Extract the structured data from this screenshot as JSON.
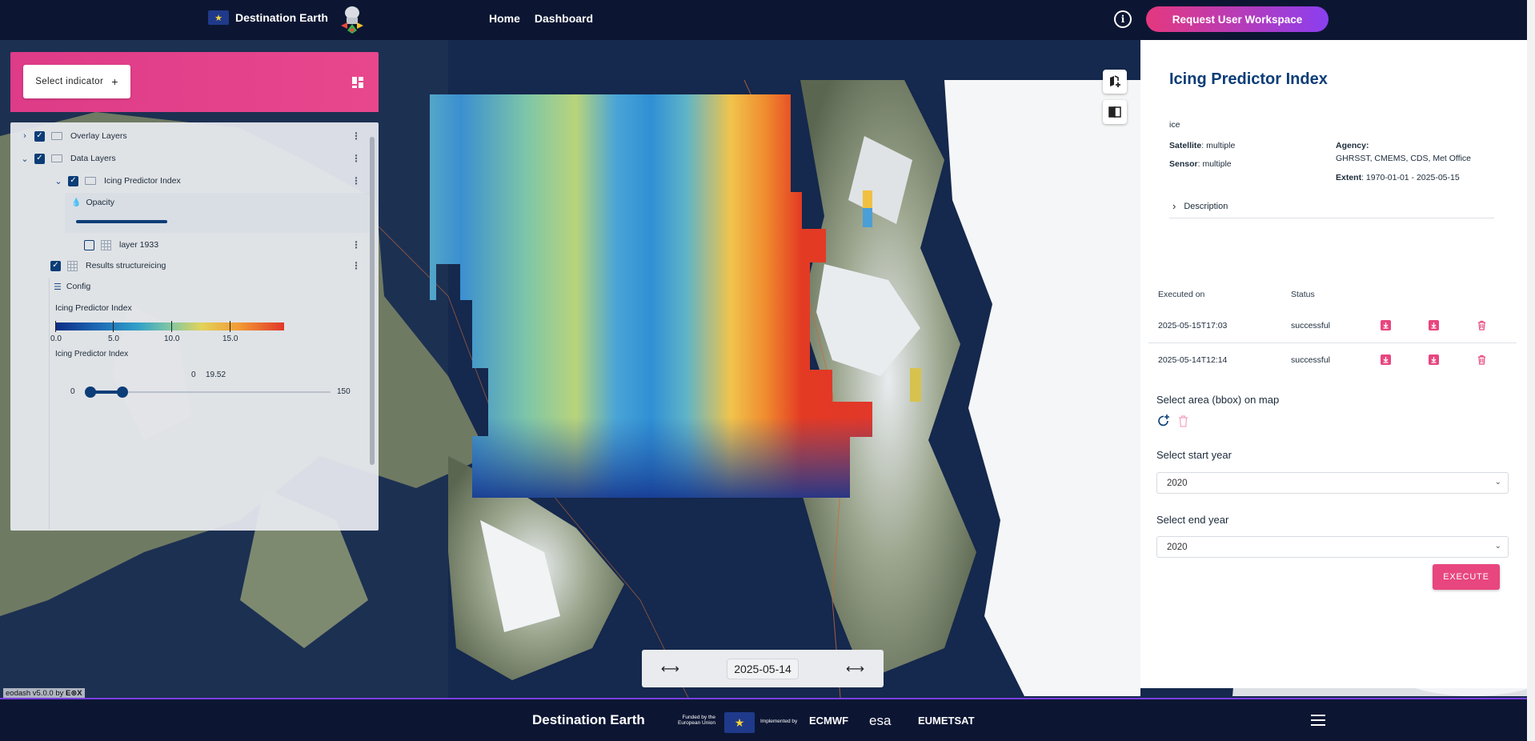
{
  "header": {
    "brand": "Destination Earth",
    "nav": [
      "Home",
      "Dashboard"
    ],
    "workspace_button": "Request User Workspace"
  },
  "left_panel": {
    "select_indicator": "Select indicator",
    "layers": {
      "overlay": "Overlay Layers",
      "data": "Data Layers",
      "icing": "Icing Predictor Index",
      "opacity": "Opacity",
      "layer1933": "layer 1933",
      "results": "Results structureicing",
      "config": "Config"
    },
    "legend": {
      "title": "Icing Predictor Index",
      "ticks": [
        "0.0",
        "5.0",
        "10.0",
        "15.0"
      ]
    },
    "range": {
      "title": "Icing Predictor Index",
      "low_value": "0",
      "high_value": "19.52",
      "min": "0",
      "max": "150"
    }
  },
  "right_panel": {
    "title": "Icing Predictor Index",
    "subtitle": "ice",
    "satellite_label": "Satellite",
    "satellite_value": ": multiple",
    "sensor_label": "Sensor",
    "sensor_value": ": multiple",
    "agency_label": "Agency",
    "agency_value": "GHRSST, CMEMS, CDS, Met Office",
    "extent_label": "Extent",
    "extent_value": ": 1970-01-01 - 2025-05-15",
    "description": "Description",
    "table": {
      "col_executed": "Executed on",
      "col_status": "Status",
      "rows": [
        {
          "executed": "2025-05-15T17:03",
          "status": "successful"
        },
        {
          "executed": "2025-05-14T12:14",
          "status": "successful"
        }
      ]
    },
    "bbox_title": "Select area (bbox) on map",
    "start_year_title": "Select start year",
    "start_year_value": "2020",
    "end_year_title": "Select end year",
    "end_year_value": "2020",
    "execute": "EXECUTE"
  },
  "timebar": {
    "date": "2025-05-14"
  },
  "version": "eodash v5.0.0 by",
  "footer": {
    "title": "Destination Earth",
    "funded": "Funded by the European Union",
    "implemented": "Implemented by",
    "logos": [
      "ECMWF",
      "esa",
      "EUMETSAT"
    ]
  },
  "colors": {
    "accent_pink": "#e8467f",
    "navy": "#0c1633",
    "title_blue": "#0c3d77"
  }
}
